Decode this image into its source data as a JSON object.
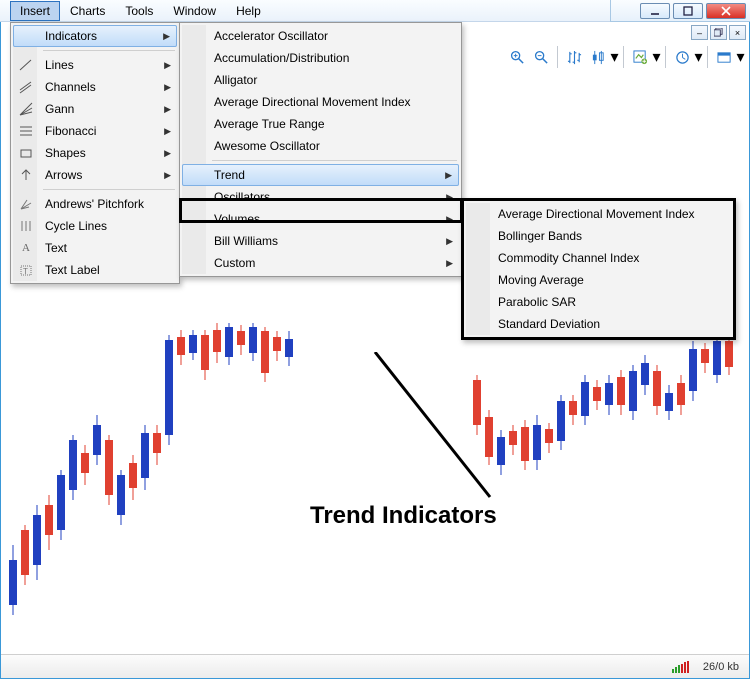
{
  "menubar": {
    "items": [
      "Insert",
      "Charts",
      "Tools",
      "Window",
      "Help"
    ],
    "open_index": 0
  },
  "menu_insert": {
    "items": [
      {
        "label": "Indicators",
        "submenu": true,
        "active": true,
        "icon": ""
      },
      {
        "sep": true
      },
      {
        "label": "Lines",
        "submenu": true,
        "icon": "line"
      },
      {
        "label": "Channels",
        "submenu": true,
        "icon": "channel"
      },
      {
        "label": "Gann",
        "submenu": true,
        "icon": "gann"
      },
      {
        "label": "Fibonacci",
        "submenu": true,
        "icon": "fib"
      },
      {
        "label": "Shapes",
        "submenu": true,
        "icon": "shape"
      },
      {
        "label": "Arrows",
        "submenu": true,
        "icon": "arrow"
      },
      {
        "sep": true
      },
      {
        "label": "Andrews' Pitchfork",
        "icon": "pitchfork"
      },
      {
        "label": "Cycle Lines",
        "icon": "cycle"
      },
      {
        "label": "Text",
        "icon": "text"
      },
      {
        "label": "Text Label",
        "icon": "label"
      }
    ]
  },
  "menu_indicators": {
    "items": [
      {
        "label": "Accelerator Oscillator"
      },
      {
        "label": "Accumulation/Distribution"
      },
      {
        "label": "Alligator"
      },
      {
        "label": "Average Directional Movement Index"
      },
      {
        "label": "Average True Range"
      },
      {
        "label": "Awesome Oscillator"
      },
      {
        "sep": true
      },
      {
        "label": "Trend",
        "submenu": true,
        "active": true
      },
      {
        "label": "Oscillators",
        "submenu": true
      },
      {
        "label": "Volumes",
        "submenu": true
      },
      {
        "label": "Bill Williams",
        "submenu": true
      },
      {
        "label": "Custom",
        "submenu": true
      }
    ]
  },
  "menu_trend": {
    "items": [
      {
        "label": "Average Directional Movement Index"
      },
      {
        "label": "Bollinger Bands"
      },
      {
        "label": "Commodity Channel Index"
      },
      {
        "label": "Moving Average"
      },
      {
        "label": "Parabolic SAR"
      },
      {
        "label": "Standard Deviation"
      }
    ]
  },
  "status": {
    "kb": "26/0 kb"
  },
  "annotation": "Trend Indicators",
  "toolbar": {
    "icons": [
      "arrow-cursor",
      "crosshair",
      "vline",
      "hline",
      "trendline",
      "channel",
      "fib",
      "text",
      "sep",
      "zoom-in",
      "zoom-out",
      "sep",
      "bars",
      "candles",
      "sep",
      "template",
      "sep",
      "clock",
      "sep",
      "list"
    ]
  }
}
